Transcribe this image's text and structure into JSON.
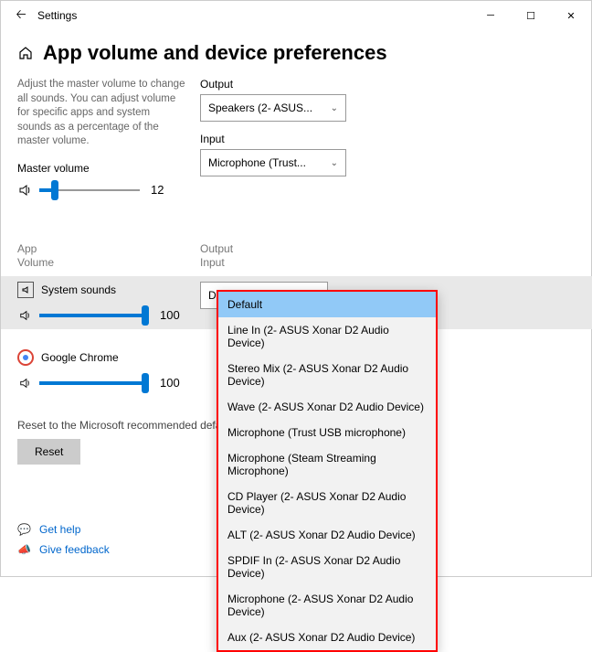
{
  "window": {
    "title": "Settings"
  },
  "page": {
    "title": "App volume and device preferences",
    "description": "Adjust the master volume to change all sounds. You can adjust volume for specific apps and system sounds as a percentage of the master volume."
  },
  "master": {
    "label": "Master volume",
    "value": "12",
    "fill_pct": "12%"
  },
  "output": {
    "label": "Output",
    "selected": "Speakers (2- ASUS..."
  },
  "input": {
    "label": "Input",
    "selected": "Microphone (Trust..."
  },
  "headers": {
    "app": "App\nVolume",
    "io": "Output\nInput"
  },
  "apps": {
    "sys": {
      "name": "System sounds",
      "vol": "100",
      "dd": "Default"
    },
    "chrome": {
      "name": "Google Chrome",
      "vol": "100"
    }
  },
  "reset": {
    "text": "Reset to the Microsoft recommended defau",
    "btn": "Reset"
  },
  "links": {
    "help": "Get help",
    "feedback": "Give feedback"
  },
  "dropdown": {
    "o0": "Default",
    "o1": "Line In (2- ASUS Xonar D2 Audio Device)",
    "o2": "Stereo Mix (2- ASUS Xonar D2 Audio Device)",
    "o3": "Wave (2- ASUS Xonar D2 Audio Device)",
    "o4": "Microphone (Trust USB microphone)",
    "o5": "Microphone (Steam Streaming Microphone)",
    "o6": "CD Player (2- ASUS Xonar D2 Audio Device)",
    "o7": "ALT (2- ASUS Xonar D2 Audio Device)",
    "o8": "SPDIF In (2- ASUS Xonar D2 Audio Device)",
    "o9": "Microphone (2- ASUS Xonar D2 Audio Device)",
    "o10": "Aux (2- ASUS Xonar D2 Audio Device)"
  }
}
